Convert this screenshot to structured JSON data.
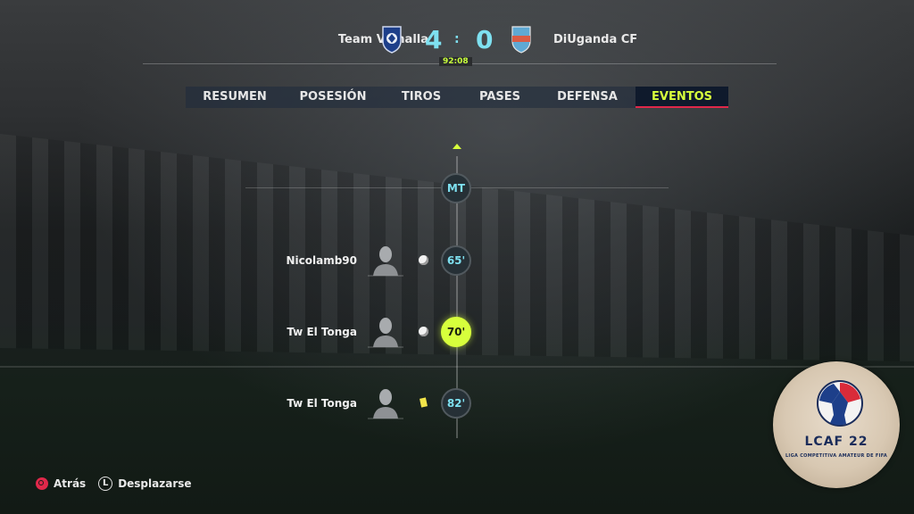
{
  "match": {
    "home_team": "Team Valhalla",
    "away_team": "DiUganda CF",
    "home_score": "4",
    "away_score": "0",
    "separator": ":",
    "clock": "92:08"
  },
  "tabs": [
    {
      "label": "RESUMEN"
    },
    {
      "label": "POSESIÓN"
    },
    {
      "label": "TIROS"
    },
    {
      "label": "PASES"
    },
    {
      "label": "DEFENSA"
    },
    {
      "label": "EVENTOS",
      "active": true
    }
  ],
  "timeline": {
    "halftime_label": "MT",
    "events": [
      {
        "player": "Nicolamb90",
        "type": "goal",
        "minute": "65'"
      },
      {
        "player": "Tw El Tonga",
        "type": "goal",
        "minute": "70'",
        "selected": true
      },
      {
        "player": "Tw El Tonga",
        "type": "yellow-card",
        "minute": "82'"
      }
    ]
  },
  "footer": {
    "back_label": "Atrás",
    "stick_glyph": "L",
    "scroll_label": "Desplazarse"
  },
  "logo": {
    "title": "LCAF 22",
    "subtitle": "LIGA COMPETITIVA AMATEUR DE FIFA"
  },
  "colors": {
    "accent": "#d7ff3c",
    "score": "#7ee0f0",
    "active_underline": "#e0284a"
  }
}
